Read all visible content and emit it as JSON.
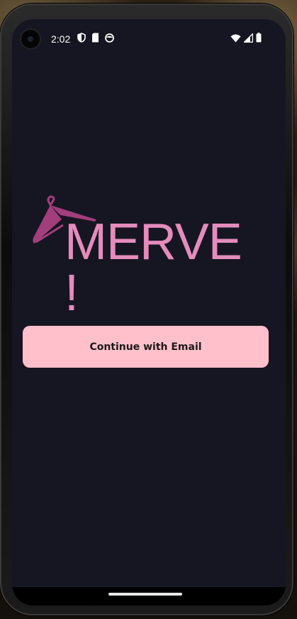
{
  "status_bar": {
    "time": "2:02",
    "left_icons": [
      "shield-icon",
      "sim-card-icon",
      "face-icon"
    ],
    "right_icons": [
      "wifi-icon",
      "signal-icon",
      "battery-icon"
    ]
  },
  "logo": {
    "text": "MERVE !",
    "icon": "hanger-icon",
    "color": "#e48cbc",
    "hanger_color": "#a33e7d"
  },
  "actions": {
    "continue_email_label": "Continue with Email"
  },
  "colors": {
    "background": "#161622",
    "button": "#ffc0cb",
    "button_text": "#1a1a1a"
  }
}
